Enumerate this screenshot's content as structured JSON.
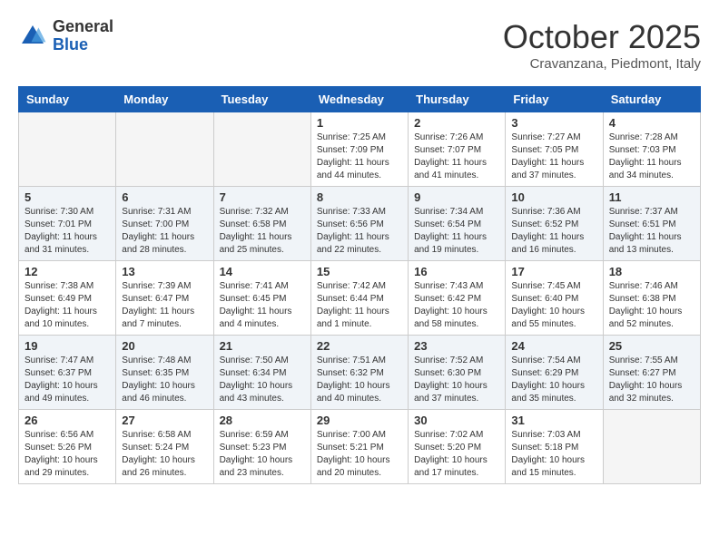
{
  "header": {
    "logo_general": "General",
    "logo_blue": "Blue",
    "month": "October 2025",
    "location": "Cravanzana, Piedmont, Italy"
  },
  "weekdays": [
    "Sunday",
    "Monday",
    "Tuesday",
    "Wednesday",
    "Thursday",
    "Friday",
    "Saturday"
  ],
  "weeks": [
    [
      {
        "day": "",
        "info": ""
      },
      {
        "day": "",
        "info": ""
      },
      {
        "day": "",
        "info": ""
      },
      {
        "day": "1",
        "info": "Sunrise: 7:25 AM\nSunset: 7:09 PM\nDaylight: 11 hours and 44 minutes."
      },
      {
        "day": "2",
        "info": "Sunrise: 7:26 AM\nSunset: 7:07 PM\nDaylight: 11 hours and 41 minutes."
      },
      {
        "day": "3",
        "info": "Sunrise: 7:27 AM\nSunset: 7:05 PM\nDaylight: 11 hours and 37 minutes."
      },
      {
        "day": "4",
        "info": "Sunrise: 7:28 AM\nSunset: 7:03 PM\nDaylight: 11 hours and 34 minutes."
      }
    ],
    [
      {
        "day": "5",
        "info": "Sunrise: 7:30 AM\nSunset: 7:01 PM\nDaylight: 11 hours and 31 minutes."
      },
      {
        "day": "6",
        "info": "Sunrise: 7:31 AM\nSunset: 7:00 PM\nDaylight: 11 hours and 28 minutes."
      },
      {
        "day": "7",
        "info": "Sunrise: 7:32 AM\nSunset: 6:58 PM\nDaylight: 11 hours and 25 minutes."
      },
      {
        "day": "8",
        "info": "Sunrise: 7:33 AM\nSunset: 6:56 PM\nDaylight: 11 hours and 22 minutes."
      },
      {
        "day": "9",
        "info": "Sunrise: 7:34 AM\nSunset: 6:54 PM\nDaylight: 11 hours and 19 minutes."
      },
      {
        "day": "10",
        "info": "Sunrise: 7:36 AM\nSunset: 6:52 PM\nDaylight: 11 hours and 16 minutes."
      },
      {
        "day": "11",
        "info": "Sunrise: 7:37 AM\nSunset: 6:51 PM\nDaylight: 11 hours and 13 minutes."
      }
    ],
    [
      {
        "day": "12",
        "info": "Sunrise: 7:38 AM\nSunset: 6:49 PM\nDaylight: 11 hours and 10 minutes."
      },
      {
        "day": "13",
        "info": "Sunrise: 7:39 AM\nSunset: 6:47 PM\nDaylight: 11 hours and 7 minutes."
      },
      {
        "day": "14",
        "info": "Sunrise: 7:41 AM\nSunset: 6:45 PM\nDaylight: 11 hours and 4 minutes."
      },
      {
        "day": "15",
        "info": "Sunrise: 7:42 AM\nSunset: 6:44 PM\nDaylight: 11 hours and 1 minute."
      },
      {
        "day": "16",
        "info": "Sunrise: 7:43 AM\nSunset: 6:42 PM\nDaylight: 10 hours and 58 minutes."
      },
      {
        "day": "17",
        "info": "Sunrise: 7:45 AM\nSunset: 6:40 PM\nDaylight: 10 hours and 55 minutes."
      },
      {
        "day": "18",
        "info": "Sunrise: 7:46 AM\nSunset: 6:38 PM\nDaylight: 10 hours and 52 minutes."
      }
    ],
    [
      {
        "day": "19",
        "info": "Sunrise: 7:47 AM\nSunset: 6:37 PM\nDaylight: 10 hours and 49 minutes."
      },
      {
        "day": "20",
        "info": "Sunrise: 7:48 AM\nSunset: 6:35 PM\nDaylight: 10 hours and 46 minutes."
      },
      {
        "day": "21",
        "info": "Sunrise: 7:50 AM\nSunset: 6:34 PM\nDaylight: 10 hours and 43 minutes."
      },
      {
        "day": "22",
        "info": "Sunrise: 7:51 AM\nSunset: 6:32 PM\nDaylight: 10 hours and 40 minutes."
      },
      {
        "day": "23",
        "info": "Sunrise: 7:52 AM\nSunset: 6:30 PM\nDaylight: 10 hours and 37 minutes."
      },
      {
        "day": "24",
        "info": "Sunrise: 7:54 AM\nSunset: 6:29 PM\nDaylight: 10 hours and 35 minutes."
      },
      {
        "day": "25",
        "info": "Sunrise: 7:55 AM\nSunset: 6:27 PM\nDaylight: 10 hours and 32 minutes."
      }
    ],
    [
      {
        "day": "26",
        "info": "Sunrise: 6:56 AM\nSunset: 5:26 PM\nDaylight: 10 hours and 29 minutes."
      },
      {
        "day": "27",
        "info": "Sunrise: 6:58 AM\nSunset: 5:24 PM\nDaylight: 10 hours and 26 minutes."
      },
      {
        "day": "28",
        "info": "Sunrise: 6:59 AM\nSunset: 5:23 PM\nDaylight: 10 hours and 23 minutes."
      },
      {
        "day": "29",
        "info": "Sunrise: 7:00 AM\nSunset: 5:21 PM\nDaylight: 10 hours and 20 minutes."
      },
      {
        "day": "30",
        "info": "Sunrise: 7:02 AM\nSunset: 5:20 PM\nDaylight: 10 hours and 17 minutes."
      },
      {
        "day": "31",
        "info": "Sunrise: 7:03 AM\nSunset: 5:18 PM\nDaylight: 10 hours and 15 minutes."
      },
      {
        "day": "",
        "info": ""
      }
    ]
  ]
}
